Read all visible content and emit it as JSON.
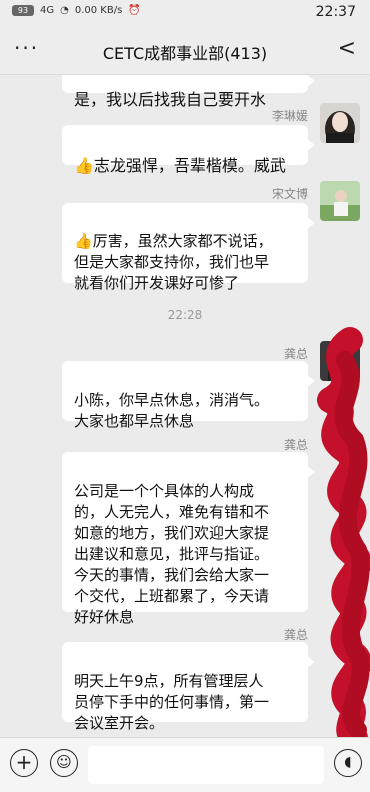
{
  "status_bar": {
    "time": "22:37",
    "battery": "93",
    "signal": "4G",
    "speed": "0.00 KB/s"
  },
  "nav": {
    "title": "CETC成都事业部(413)",
    "more_label": "···",
    "back_label": "<"
  },
  "messages": [
    {
      "text": "是，我以后找我自己要开水"
    },
    {
      "sender": "李琳媛",
      "text": "👍志龙强悍，吾辈楷模。威武"
    },
    {
      "sender": "宋文博",
      "text": "👍厉害，虽然大家都不说话，\n但是大家都支持你，我们也早\n就看你们开发课好可惨了"
    },
    {
      "timestamp": "22:28"
    },
    {
      "sender": "龚总",
      "text": "小陈，你早点休息，消消气。\n大家也都早点休息"
    },
    {
      "sender": "龚总",
      "text": "公司是一个个具体的人构成\n的，人无完人，难免有错和不\n如意的地方，我们欢迎大家提\n出建议和意见，批评与指证。\n今天的事情，我们会给大家一\n个交代，上班都累了，今天请\n好好休息"
    },
    {
      "sender": "龚总",
      "text": "明天上午9点，所有管理层人\n员停下手中的任何事情，第一\n会议室开会。"
    }
  ],
  "input_bar": {
    "placeholder": ""
  },
  "colors": {
    "background": "#ebebeb",
    "bubble": "#ffffff",
    "scribble": "#c4102a"
  }
}
